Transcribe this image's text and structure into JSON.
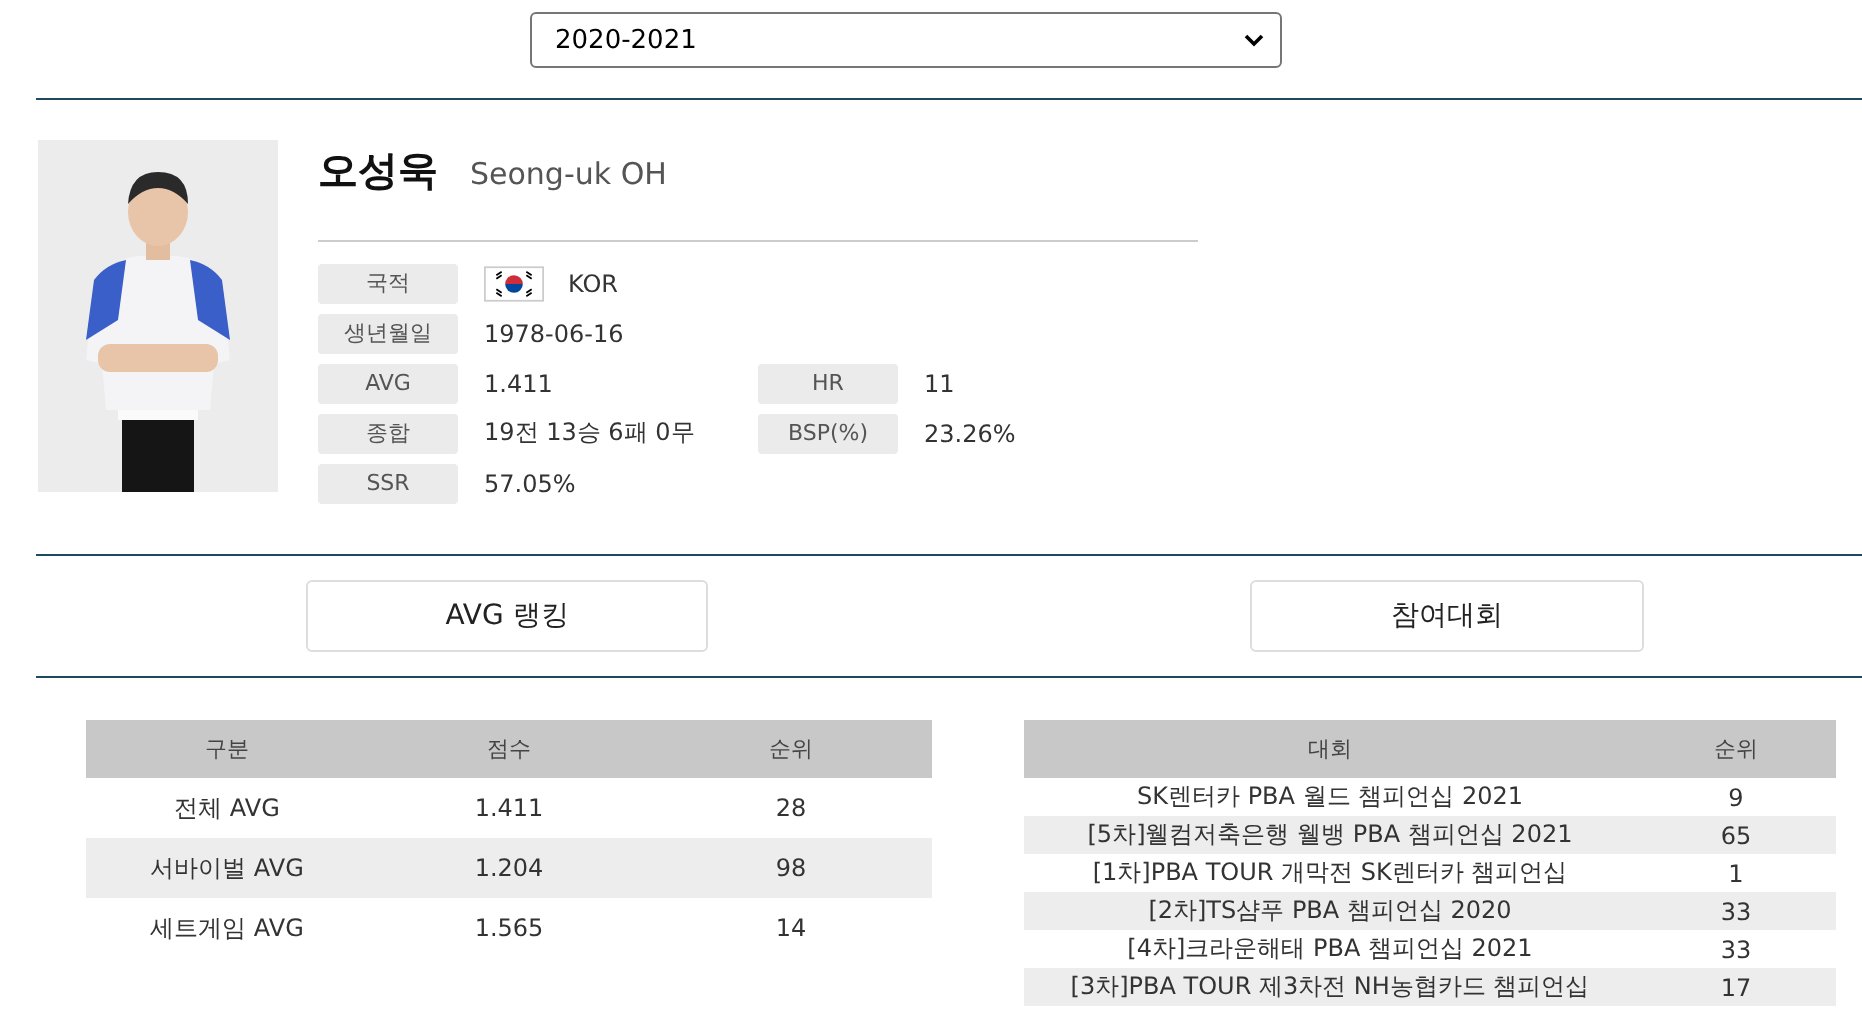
{
  "season_select": {
    "value": "2020-2021"
  },
  "player": {
    "name": "오성욱",
    "name_en": "Seong-uk OH",
    "info": [
      {
        "label": "국적",
        "value": "KOR",
        "kind": "flag"
      },
      {
        "label": "생년월일",
        "value": "1978-06-16"
      },
      {
        "label": "AVG",
        "value": "1.411"
      },
      {
        "label": "HR",
        "value": "11"
      },
      {
        "label": "종합",
        "value": "19전 13승 6패 0무"
      },
      {
        "label": "BSP(%)",
        "value": "23.26%"
      },
      {
        "label": "SSR",
        "value": "57.05%"
      }
    ]
  },
  "tabs": [
    {
      "label": "AVG 랭킹"
    },
    {
      "label": "참여대회"
    }
  ],
  "avg_table": {
    "columns": [
      "구분",
      "점수",
      "순위"
    ],
    "rows": [
      [
        "전체 AVG",
        "1.411",
        "28"
      ],
      [
        "서바이벌 AVG",
        "1.204",
        "98"
      ],
      [
        "세트게임 AVG",
        "1.565",
        "14"
      ]
    ]
  },
  "events_table": {
    "columns": [
      "대회",
      "순위"
    ],
    "rows": [
      [
        "SK렌터카 PBA 월드 챔피언십 2021",
        "9"
      ],
      [
        "[5차]웰컴저축은행 웰뱅 PBA 챔피언십 2021",
        "65"
      ],
      [
        "[1차]PBA TOUR 개막전 SK렌터카 챔피언십",
        "1"
      ],
      [
        "[2차]TS샴푸 PBA 챔피언십 2020",
        "33"
      ],
      [
        "[4차]크라운해태 PBA 챔피언십 2021",
        "33"
      ],
      [
        "[3차]PBA TOUR 제3차전 NH농협카드 챔피언십",
        "17"
      ]
    ]
  }
}
